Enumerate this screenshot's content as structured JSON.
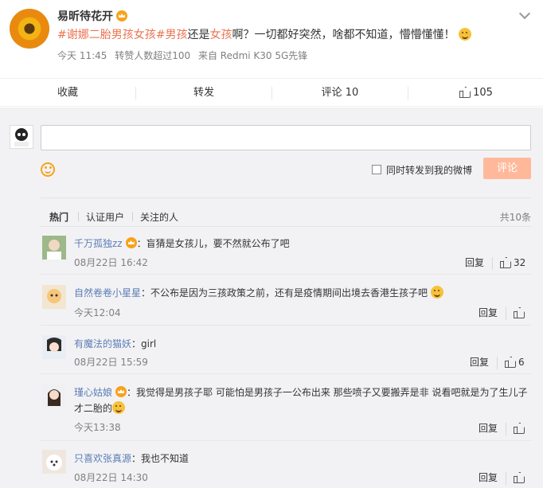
{
  "post": {
    "author": "易昕待花开",
    "hashtag1": "#谢娜二胎男孩女孩#",
    "hashtag2": "男孩",
    "text_mid": "还是",
    "hashtag3": "女孩",
    "text_rest": "啊？一切都好突然，啥都不知道，懵懵懂懂！",
    "time": "今天 11:45",
    "forwards_note": "转赞人数超过100",
    "source": "来自 Redmi K30 5G先锋"
  },
  "actions": {
    "collect": "收藏",
    "forward": "转发",
    "comment": "评论 10",
    "like": "105"
  },
  "composer": {
    "forward_label": "同时转发到我的微博",
    "submit_label": "评论"
  },
  "filters": {
    "hot": "热门",
    "verified": "认证用户",
    "following": "关注的人",
    "total": "共10条"
  },
  "comments": [
    {
      "name": "千万孤独zz",
      "text": "：盲猜是女孩儿，要不然就公布了吧",
      "time": "08月22日 16:42",
      "reply": "回复",
      "likes": "32"
    },
    {
      "name": "自然卷卷小星星",
      "text": "：不公布是因为三孩政策之前，还有是疫情期间出境去香港生孩子吧",
      "time": "今天12:04",
      "reply": "回复",
      "likes": ""
    },
    {
      "name": "有魔法的猫妖",
      "text": "：girl",
      "time": "08月22日 15:59",
      "reply": "回复",
      "likes": "6"
    },
    {
      "name": "瑾心姑娘",
      "text": "：我觉得是男孩子耶 可能怕是男孩子一公布出来 那些喷子又要搬弄是非 说看吧就是为了生儿子",
      "text2": "才二胎的",
      "time": "今天13:38",
      "reply": "回复",
      "likes": ""
    },
    {
      "name": "只喜欢张真源",
      "text": "：我也不知道",
      "time": "08月22日 14:30",
      "reply": "回复",
      "likes": ""
    }
  ],
  "colors": {
    "accent": "#eb7350",
    "link": "#5c7db5",
    "vip": "#f7a21b",
    "submit_disabled": "#ffb99a"
  }
}
